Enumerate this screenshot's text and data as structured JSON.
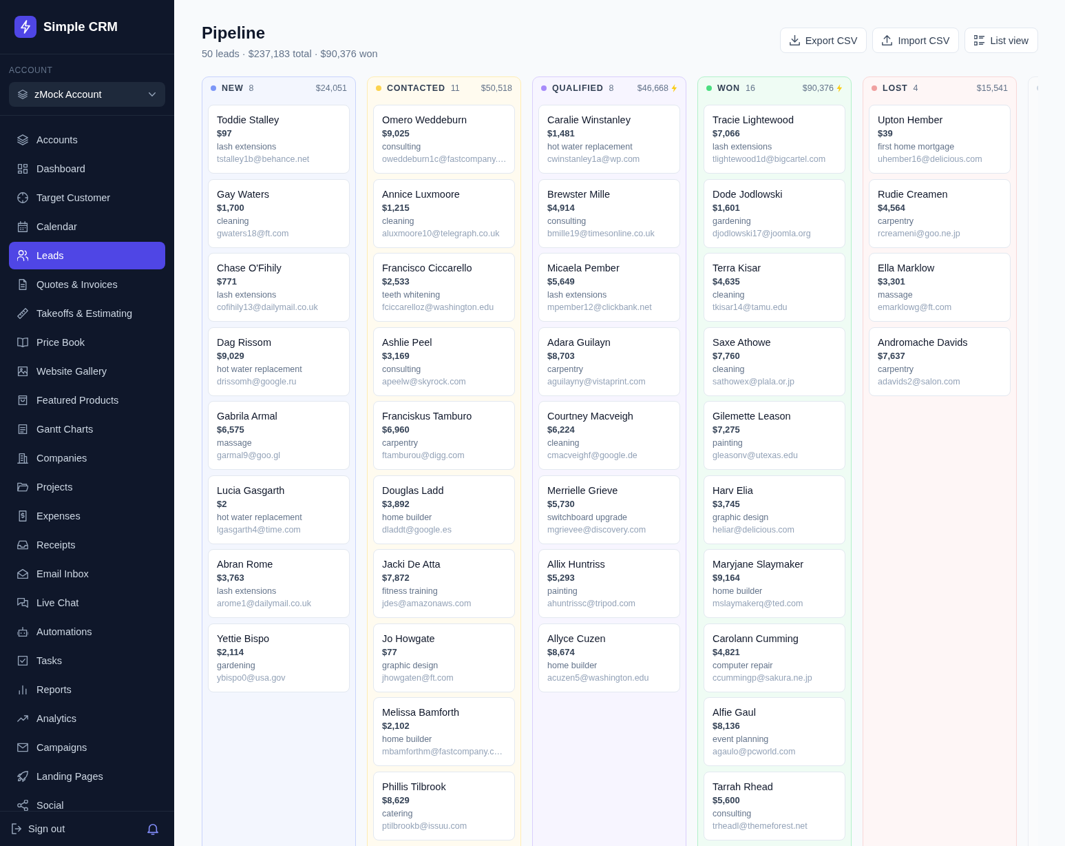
{
  "sidebar": {
    "brand": "Simple CRM",
    "account_label": "ACCOUNT",
    "account": "zMock Account",
    "nav": [
      {
        "label": "Accounts",
        "selected": false
      },
      {
        "label": "Dashboard",
        "selected": false
      },
      {
        "label": "Target Customer",
        "selected": false
      },
      {
        "label": "Calendar",
        "selected": false
      },
      {
        "label": "Leads",
        "selected": true
      },
      {
        "label": "Quotes & Invoices",
        "selected": false
      },
      {
        "label": "Takeoffs & Estimating",
        "selected": false
      },
      {
        "label": "Price Book",
        "selected": false
      },
      {
        "label": "Website Gallery",
        "selected": false
      },
      {
        "label": "Featured Products",
        "selected": false
      },
      {
        "label": "Gantt Charts",
        "selected": false
      },
      {
        "label": "Companies",
        "selected": false
      },
      {
        "label": "Projects",
        "selected": false
      },
      {
        "label": "Expenses",
        "selected": false
      },
      {
        "label": "Receipts",
        "selected": false
      },
      {
        "label": "Email Inbox",
        "selected": false
      },
      {
        "label": "Live Chat",
        "selected": false
      },
      {
        "label": "Automations",
        "selected": false
      },
      {
        "label": "Tasks",
        "selected": false
      },
      {
        "label": "Reports",
        "selected": false
      },
      {
        "label": "Analytics",
        "selected": false
      },
      {
        "label": "Campaigns",
        "selected": false
      },
      {
        "label": "Landing Pages",
        "selected": false
      },
      {
        "label": "Social",
        "selected": false
      }
    ],
    "sign_out": "Sign out"
  },
  "header": {
    "title": "Pipeline",
    "summary": "50 leads · $237,183 total · $90,376 won",
    "buttons": [
      "Export CSV",
      "Import CSV",
      "List view"
    ]
  },
  "columns": [
    {
      "name": "NEW",
      "count": "8",
      "total": "$24,051",
      "color": "#7c96f7",
      "bolt": false,
      "cards": [
        {
          "name": "Toddie Stalley",
          "value": "$97",
          "service": "lash extensions",
          "email": "tstalley1b@behance.net"
        },
        {
          "name": "Gay Waters",
          "value": "$1,700",
          "service": "cleaning",
          "email": "gwaters18@ft.com"
        },
        {
          "name": "Chase O'Fihily",
          "value": "$771",
          "service": "lash extensions",
          "email": "cofihily13@dailymail.co.uk"
        },
        {
          "name": "Dag Rissom",
          "value": "$9,029",
          "service": "hot water replacement",
          "email": "drissomh@google.ru"
        },
        {
          "name": "Gabrila Armal",
          "value": "$6,575",
          "service": "massage",
          "email": "garmal9@goo.gl"
        },
        {
          "name": "Lucia Gasgarth",
          "value": "$2",
          "service": "hot water replacement",
          "email": "lgasgarth4@time.com"
        },
        {
          "name": "Abran Rome",
          "value": "$3,763",
          "service": "lash extensions",
          "email": "arome1@dailymail.co.uk"
        },
        {
          "name": "Yettie Bispo",
          "value": "$2,114",
          "service": "gardening",
          "email": "ybispo0@usa.gov"
        }
      ]
    },
    {
      "name": "CONTACTED",
      "count": "11",
      "total": "$50,518",
      "color": "#fcd34d",
      "bolt": false,
      "cards": [
        {
          "name": "Omero Weddeburn",
          "value": "$9,025",
          "service": "consulting",
          "email": "oweddeburn1c@fastcompany.…"
        },
        {
          "name": "Annice Luxmoore",
          "value": "$1,215",
          "service": "cleaning",
          "email": "aluxmoore10@telegraph.co.uk"
        },
        {
          "name": "Francisco Ciccarello",
          "value": "$2,533",
          "service": "teeth whitening",
          "email": "fciccarelloz@washington.edu"
        },
        {
          "name": "Ashlie Peel",
          "value": "$3,169",
          "service": "consulting",
          "email": "apeelw@skyrock.com"
        },
        {
          "name": "Franciskus Tamburo",
          "value": "$6,960",
          "service": "carpentry",
          "email": "ftamburou@digg.com"
        },
        {
          "name": "Douglas Ladd",
          "value": "$3,892",
          "service": "home builder",
          "email": "dladdt@google.es"
        },
        {
          "name": "Jacki De Atta",
          "value": "$7,872",
          "service": "fitness training",
          "email": "jdes@amazonaws.com"
        },
        {
          "name": "Jo Howgate",
          "value": "$77",
          "service": "graphic design",
          "email": "jhowgaten@ft.com"
        },
        {
          "name": "Melissa Bamforth",
          "value": "$2,102",
          "service": "home builder",
          "email": "mbamforthm@fastcompany.c…"
        },
        {
          "name": "Phillis Tilbrook",
          "value": "$8,629",
          "service": "catering",
          "email": "ptilbrookb@issuu.com"
        }
      ]
    },
    {
      "name": "QUALIFIED",
      "count": "8",
      "total": "$46,668",
      "color": "#a78bfa",
      "bolt": true,
      "cards": [
        {
          "name": "Caralie Winstanley",
          "value": "$1,481",
          "service": "hot water replacement",
          "email": "cwinstanley1a@wp.com"
        },
        {
          "name": "Brewster Mille",
          "value": "$4,914",
          "service": "consulting",
          "email": "bmille19@timesonline.co.uk"
        },
        {
          "name": "Micaela Pember",
          "value": "$5,649",
          "service": "lash extensions",
          "email": "mpember12@clickbank.net"
        },
        {
          "name": "Adara Guilayn",
          "value": "$8,703",
          "service": "carpentry",
          "email": "aguilayny@vistaprint.com"
        },
        {
          "name": "Courtney Macveigh",
          "value": "$6,224",
          "service": "cleaning",
          "email": "cmacveighf@google.de"
        },
        {
          "name": "Merrielle Grieve",
          "value": "$5,730",
          "service": "switchboard upgrade",
          "email": "mgrievee@discovery.com"
        },
        {
          "name": "Allix Huntriss",
          "value": "$5,293",
          "service": "painting",
          "email": "ahuntrissc@tripod.com"
        },
        {
          "name": "Allyce Cuzen",
          "value": "$8,674",
          "service": "home builder",
          "email": "acuzen5@washington.edu"
        }
      ]
    },
    {
      "name": "WON",
      "count": "16",
      "total": "$90,376",
      "color": "#4ade80",
      "bolt": true,
      "cards": [
        {
          "name": "Tracie Lightewood",
          "value": "$7,066",
          "service": "lash extensions",
          "email": "tlightewood1d@bigcartel.com"
        },
        {
          "name": "Dode Jodlowski",
          "value": "$1,601",
          "service": "gardening",
          "email": "djodlowski17@joomla.org"
        },
        {
          "name": "Terra Kisar",
          "value": "$4,635",
          "service": "cleaning",
          "email": "tkisar14@tamu.edu"
        },
        {
          "name": "Saxe Athowe",
          "value": "$7,760",
          "service": "cleaning",
          "email": "sathowex@plala.or.jp"
        },
        {
          "name": "Gilemette Leason",
          "value": "$7,275",
          "service": "painting",
          "email": "gleasonv@utexas.edu"
        },
        {
          "name": "Harv Elia",
          "value": "$3,745",
          "service": "graphic design",
          "email": "heliar@delicious.com"
        },
        {
          "name": "Maryjane Slaymaker",
          "value": "$9,164",
          "service": "home builder",
          "email": "mslaymakerq@ted.com"
        },
        {
          "name": "Carolann Cumming",
          "value": "$4,821",
          "service": "computer repair",
          "email": "ccummingp@sakura.ne.jp"
        },
        {
          "name": "Alfie Gaul",
          "value": "$8,136",
          "service": "event planning",
          "email": "agaulo@pcworld.com"
        },
        {
          "name": "Tarrah Rhead",
          "value": "$5,600",
          "service": "consulting",
          "email": "trheadl@themeforest.net"
        }
      ]
    },
    {
      "name": "LOST",
      "count": "4",
      "total": "$15,541",
      "color": "#f0a0a0",
      "bolt": false,
      "cards": [
        {
          "name": "Upton Hember",
          "value": "$39",
          "service": "first home mortgage",
          "email": "uhember16@delicious.com"
        },
        {
          "name": "Rudie Creamen",
          "value": "$4,564",
          "service": "carpentry",
          "email": "rcreameni@goo.ne.jp"
        },
        {
          "name": "Ella Marklow",
          "value": "$3,301",
          "service": "massage",
          "email": "emarklowg@ft.com"
        },
        {
          "name": "Andromache Davids",
          "value": "$7,637",
          "service": "carpentry",
          "email": "adavids2@salon.com"
        }
      ]
    },
    {
      "color": "#cbd5e1"
    }
  ]
}
